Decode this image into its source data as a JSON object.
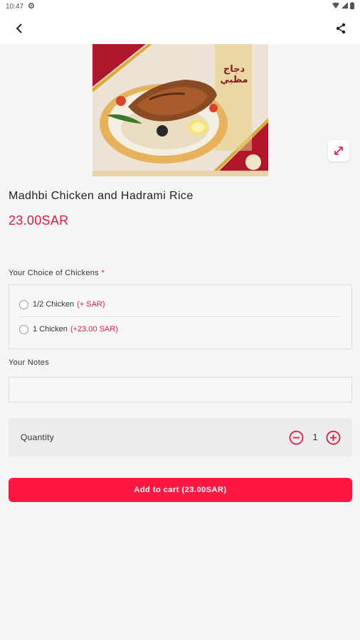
{
  "status_bar": {
    "time": "10:47"
  },
  "product": {
    "image_caption": "دجاج مظبي",
    "title": "Madhbi Chicken and Hadrami Rice",
    "price": "23.00SAR"
  },
  "choices": {
    "label": "Your Choice of Chickens",
    "required_mark": "*",
    "options": [
      {
        "label": "1/2 Chicken",
        "price": "(+ SAR)"
      },
      {
        "label": "1 Chicken",
        "price": "(+23.00 SAR)"
      }
    ]
  },
  "notes": {
    "label": "Your Notes",
    "placeholder": ""
  },
  "quantity": {
    "label": "Quantity",
    "value": "1"
  },
  "cart": {
    "button_label": "Add to cart (23.00SAR)"
  },
  "colors": {
    "accent": "#ff1744",
    "price": "#e8173f",
    "background": "#f5f5f5"
  },
  "icons": [
    "settings-icon",
    "wifi-icon",
    "signal-icon",
    "battery-icon",
    "back-arrow-icon",
    "share-icon",
    "expand-icon",
    "minus-circle-icon",
    "plus-circle-icon"
  ]
}
